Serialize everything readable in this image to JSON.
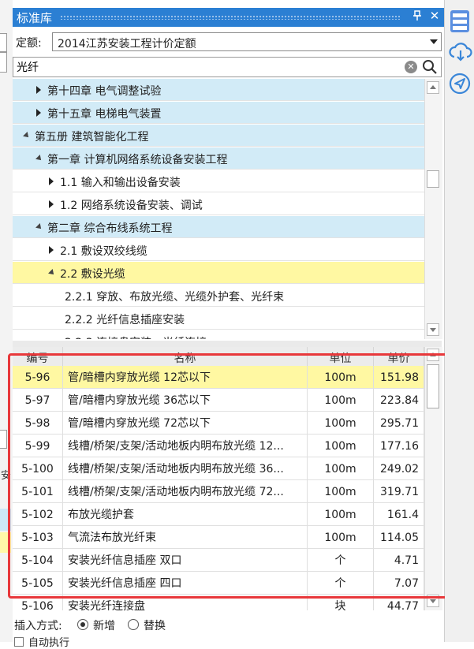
{
  "panel": {
    "title": "标准库",
    "pin_glyph": "📌",
    "close_glyph": "✕",
    "quota_label": "定额:",
    "quota_value": "2014江苏安装工程计价定额",
    "search_value": "光纤",
    "clear_glyph": "✕"
  },
  "left_strip": {
    "fragment_char": "安"
  },
  "tree": [
    {
      "level": 2,
      "expander": "collapsed",
      "label": "第十四章 电气调整试验",
      "state": "blue"
    },
    {
      "level": 2,
      "expander": "collapsed",
      "label": "第十五章 电梯电气装置",
      "state": "blue"
    },
    {
      "level": 1,
      "expander": "expanded",
      "label": "第五册 建筑智能化工程",
      "state": "blue"
    },
    {
      "level": 2,
      "expander": "expanded",
      "label": "第一章 计算机网络系统设备安装工程",
      "state": "blue"
    },
    {
      "level": 3,
      "expander": "collapsed",
      "label": "1.1 输入和输出设备安装",
      "state": "white"
    },
    {
      "level": 3,
      "expander": "collapsed",
      "label": "1.2 网络系统设备安装、调试",
      "state": "white"
    },
    {
      "level": 2,
      "expander": "expanded",
      "label": "第二章 综合布线系统工程",
      "state": "blue"
    },
    {
      "level": 3,
      "expander": "collapsed",
      "label": "2.1 敷设双绞线缆",
      "state": "white"
    },
    {
      "level": 3,
      "expander": "expanded",
      "label": "2.2 敷设光缆",
      "state": "yellow"
    },
    {
      "level": 4,
      "expander": "none",
      "label": "2.2.1 穿放、布放光缆、光缆外护套、光纤束",
      "state": "white"
    },
    {
      "level": 4,
      "expander": "none",
      "label": "2.2.2 光纤信息插座安装",
      "state": "white"
    },
    {
      "level": 4,
      "expander": "none",
      "label": "2.2.3 连接盘安装、光纤连接",
      "state": "white"
    }
  ],
  "grid": {
    "headers": {
      "code": "编号",
      "name": "名称",
      "unit": "单位",
      "price": "单价"
    },
    "rows": [
      {
        "code": "5-96",
        "name": "管/暗槽内穿放光缆 12芯以下",
        "unit": "100m",
        "price": "151.98",
        "selected": true
      },
      {
        "code": "5-97",
        "name": "管/暗槽内穿放光缆 36芯以下",
        "unit": "100m",
        "price": "223.84"
      },
      {
        "code": "5-98",
        "name": "管/暗槽内穿放光缆 72芯以下",
        "unit": "100m",
        "price": "295.71"
      },
      {
        "code": "5-99",
        "name": "线槽/桥架/支架/活动地板内明布放光缆 12...",
        "unit": "100m",
        "price": "177.16"
      },
      {
        "code": "5-100",
        "name": "线槽/桥架/支架/活动地板内明布放光缆 36...",
        "unit": "100m",
        "price": "249.02"
      },
      {
        "code": "5-101",
        "name": "线槽/桥架/支架/活动地板内明布放光缆 72...",
        "unit": "100m",
        "price": "319.71"
      },
      {
        "code": "5-102",
        "name": "布放光缆护套",
        "unit": "100m",
        "price": "161.4"
      },
      {
        "code": "5-103",
        "name": "气流法布放光纤束",
        "unit": "100m",
        "price": "114.05"
      },
      {
        "code": "5-104",
        "name": "安装光纤信息插座 双口",
        "unit": "个",
        "price": "4.71"
      },
      {
        "code": "5-105",
        "name": "安装光纤信息插座 四口",
        "unit": "个",
        "price": "7.07"
      },
      {
        "code": "5-106",
        "name": "安装光纤连接盘",
        "unit": "块",
        "price": "44.77"
      }
    ]
  },
  "footer": {
    "insert_label": "插入方式:",
    "option_add": "新增",
    "option_replace": "替换",
    "auto_label": "自动执行"
  },
  "right_toolbar": {
    "icons": [
      "database-icon",
      "cloud-download-icon",
      "send-icon"
    ]
  },
  "colors": {
    "title_blue": "#2b7fd3",
    "row_blue": "#d2ebf7",
    "row_yellow": "#fff8a2",
    "highlight_red": "#e8383b"
  }
}
